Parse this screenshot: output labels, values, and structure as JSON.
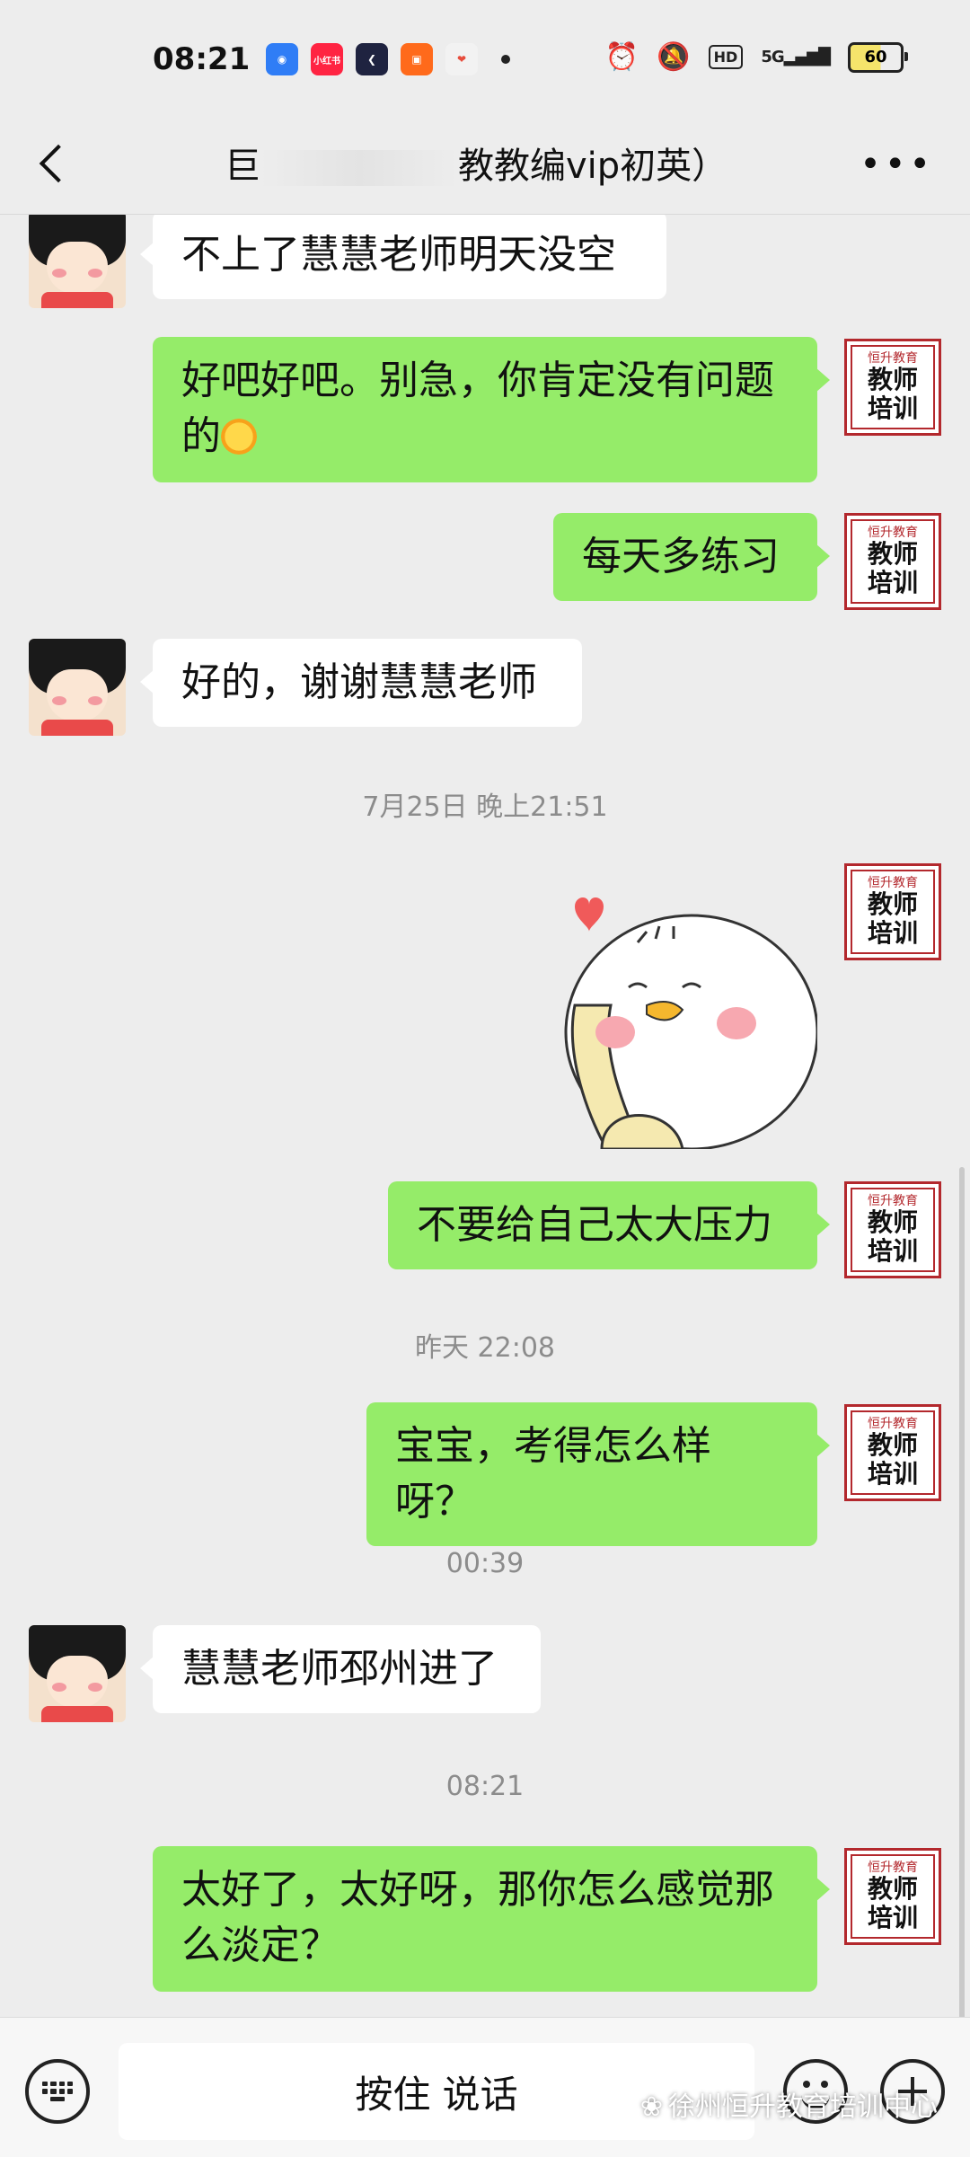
{
  "status_bar": {
    "time": "08:21",
    "apps": [
      {
        "name": "app-blue-icon",
        "color": "#2f7df6",
        "label": "◉"
      },
      {
        "name": "xiaohongshu-icon",
        "color": "#ff2442",
        "label": "小红书"
      },
      {
        "name": "app-dark-icon",
        "color": "#1f2340",
        "label": "❮"
      },
      {
        "name": "kuaishou-icon",
        "color": "#ff6a1b",
        "label": "▣"
      },
      {
        "name": "app-red-pin-icon",
        "color": "#e74c3c",
        "label": "❤"
      }
    ],
    "hd": "HD",
    "network": "5G",
    "battery": "60"
  },
  "header": {
    "title_prefix": "巨",
    "title_suffix": "教教编vip初英）"
  },
  "messages": [
    {
      "type": "text",
      "side": "left",
      "text": "不上了慧慧老师明天没空"
    },
    {
      "type": "text",
      "side": "right",
      "text": "好吧好吧。别急，你肯定没有问题的"
    },
    {
      "type": "text",
      "side": "right",
      "text": "每天多练习"
    },
    {
      "type": "text",
      "side": "left",
      "text": "好的，谢谢慧慧老师"
    },
    {
      "type": "time",
      "text": "7月25日 晚上21:51"
    },
    {
      "type": "sticker",
      "side": "right"
    },
    {
      "type": "text",
      "side": "right",
      "text": "不要给自己太大压力"
    },
    {
      "type": "time",
      "text": "昨天 22:08"
    },
    {
      "type": "text",
      "side": "right",
      "text": "宝宝，考得怎么样呀？"
    },
    {
      "type": "time",
      "text": "00:39"
    },
    {
      "type": "text",
      "side": "left",
      "text": "慧慧老师邳州进了"
    },
    {
      "type": "time",
      "text": "08:21"
    },
    {
      "type": "text",
      "side": "right",
      "text": "太好了，太好呀，那你怎么感觉那么淡定？"
    }
  ],
  "teacher_avatar": {
    "small": "恒升教育",
    "line1": "教师",
    "line2": "培训"
  },
  "bottom_bar": {
    "talk_label": "按住 说话"
  },
  "watermark": "徐州恒升教育培训中心",
  "colors": {
    "background": "#ededed",
    "bubble_right": "#95ec69",
    "bubble_left": "#ffffff",
    "avatar_red": "#b3282d"
  }
}
